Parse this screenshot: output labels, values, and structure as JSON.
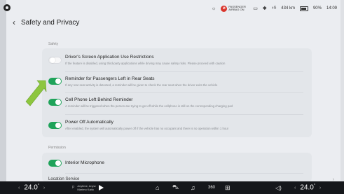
{
  "status_bar": {
    "airbag_text": "PASSENGER AIRBAG ON",
    "range": "434 km",
    "battery_pct": "90%",
    "time": "14:09"
  },
  "header": {
    "title": "Safety and Privacy"
  },
  "sections": {
    "safety_label": "Safety",
    "permission_label": "Permission"
  },
  "safety_items": [
    {
      "title": "Driver's Screen Application Use Restrictions",
      "description": "If the feature is disabled, using third-party applications while driving may cause safety risks. Please proceed with caution",
      "enabled": false
    },
    {
      "title": "Reminder for Passengers Left in Rear Seats",
      "description": "If any rear seat activity is detected, a reminder will be given to check the rear seat when the driver exits the vehicle",
      "enabled": true
    },
    {
      "title": "Cell Phone Left Behind Reminder",
      "description": "A reminder will be triggered when the person are trying to get off while the cellphone is still on the corresponding charging pad",
      "enabled": true
    },
    {
      "title": "Power Off Automatically",
      "description": "After enabled, the system will automatically power off if the vehicle has no occupant and there is no operation within 1 hour",
      "enabled": true
    }
  ],
  "permission_items": [
    {
      "title": "Interior Microphone",
      "enabled": true
    }
  ],
  "location_service": "Location Service",
  "dock": {
    "left_temp": "24.0",
    "right_temp": "24.0",
    "degree": "°",
    "track_title": "Anytime, Anyw",
    "track_artist": "Marimo Kaito",
    "mode_label": "P",
    "view_label": "360"
  },
  "colors": {
    "toggle_on": "#1fa35a",
    "arrow": "#8dc63f",
    "airbag_badge": "#d9342b"
  }
}
